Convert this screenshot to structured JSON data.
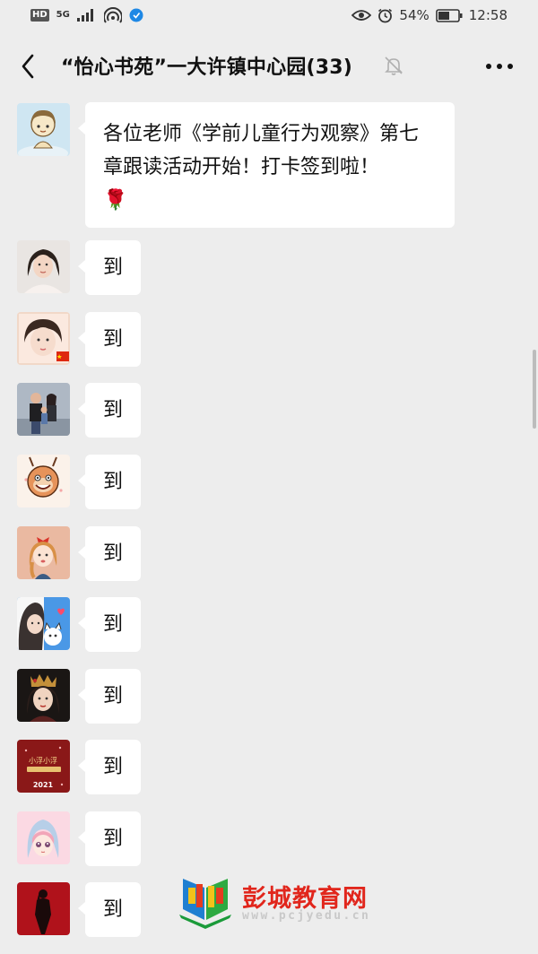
{
  "status": {
    "hd": "HD",
    "network": "5G",
    "battery": "54%",
    "time": "12:58"
  },
  "nav": {
    "title": "“怡心书苑”一大许镇中心园(33)"
  },
  "messages": [
    {
      "text": "各位老师《学前儿童行为观察》第七章跟读活动开始！打卡签到啦！",
      "emoji": "🌹"
    },
    {
      "text": "到"
    },
    {
      "text": "到"
    },
    {
      "text": "到"
    },
    {
      "text": "到"
    },
    {
      "text": "到"
    },
    {
      "text": "到"
    },
    {
      "text": "到"
    },
    {
      "text": "到"
    },
    {
      "text": "到"
    },
    {
      "text": "到"
    }
  ],
  "avatars": {
    "a4_text1": "小浮小浮",
    "a4_text2": "2021"
  },
  "watermark": {
    "name": "彭城教育网",
    "url": "www.pcjyedu.cn"
  },
  "colors": {
    "background": "#ededed",
    "bubble": "#ffffff",
    "watermark_red": "#e1261c"
  }
}
